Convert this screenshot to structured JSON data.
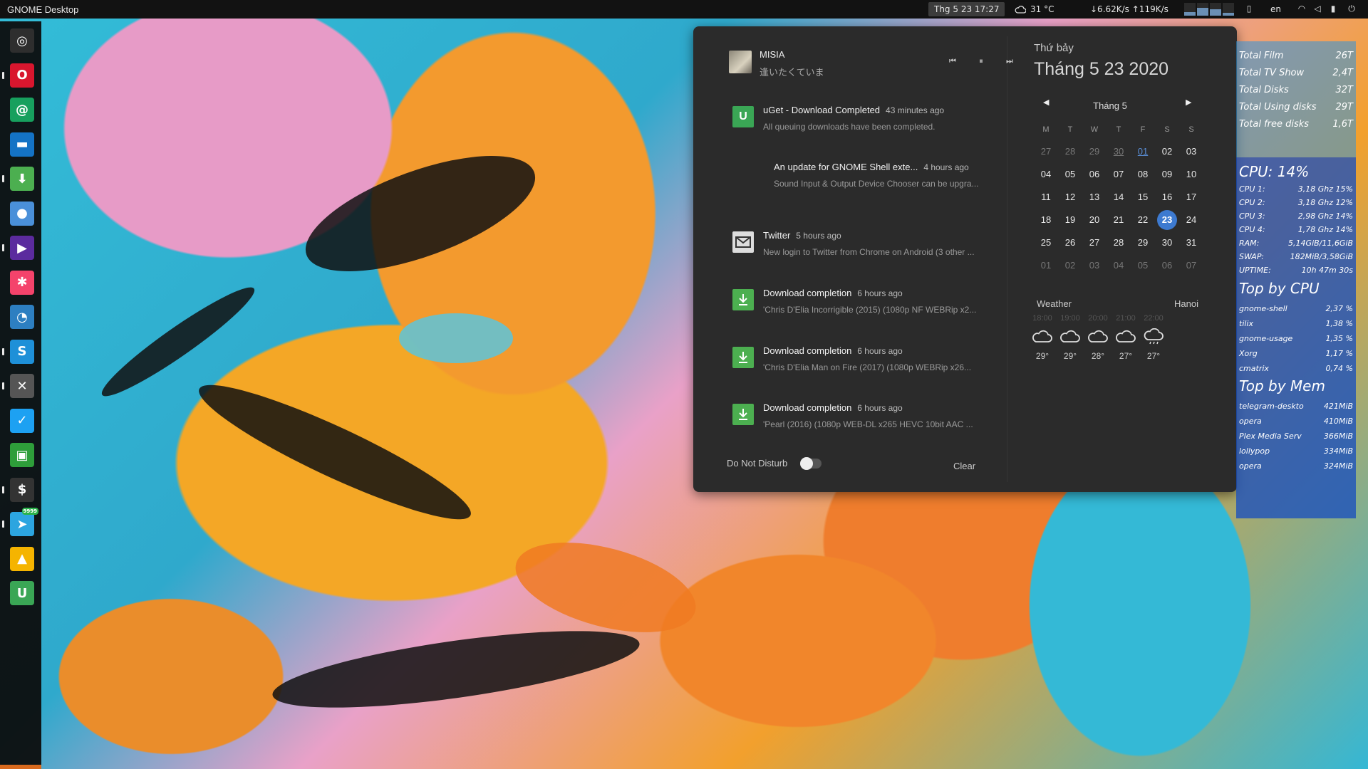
{
  "topbar": {
    "app_title": "GNOME Desktop",
    "clock": "Thg 5 23  17:27",
    "weather_temp": "31 °C",
    "weather_icon": "cloud-icon",
    "netspeed": "↓6.62K/s ↑119K/s",
    "lang": "en",
    "sysmon_levels": [
      0.3,
      0.6,
      0.5,
      0.2
    ]
  },
  "dock": {
    "items": [
      {
        "name": "chromium-icon",
        "glyph": "◎",
        "color": "#2e2e2e"
      },
      {
        "name": "opera-icon",
        "glyph": "O",
        "color": "#d9162e"
      },
      {
        "name": "email-icon",
        "glyph": "@",
        "color": "#17a05e"
      },
      {
        "name": "files-icon",
        "glyph": "▬",
        "color": "#1473c5"
      },
      {
        "name": "downloader-icon",
        "glyph": "⬇",
        "color": "#4caf50"
      },
      {
        "name": "gamepad-icon",
        "glyph": "●",
        "color": "#4a90d9"
      },
      {
        "name": "media-player-icon",
        "glyph": "▶",
        "color": "#5b2b9e"
      },
      {
        "name": "pinwheel-icon",
        "glyph": "✱",
        "color": "#f4436b"
      },
      {
        "name": "system-monitor-icon",
        "glyph": "◔",
        "color": "#2d7fc1"
      },
      {
        "name": "skype-icon",
        "glyph": "S",
        "color": "#1e90d8"
      },
      {
        "name": "tools-icon",
        "glyph": "✕",
        "color": "#555555"
      },
      {
        "name": "twitter-icon",
        "glyph": "✓",
        "color": "#1da1f2"
      },
      {
        "name": "video-icon",
        "glyph": "▣",
        "color": "#2e9e3a"
      },
      {
        "name": "terminal-icon",
        "glyph": "$",
        "color": "#333333"
      },
      {
        "name": "telegram-icon",
        "glyph": "➤",
        "color": "#2ca5e0"
      },
      {
        "name": "google-drive-icon",
        "glyph": "▲",
        "color": "#f5b400"
      },
      {
        "name": "uget-icon",
        "glyph": "U",
        "color": "#3aa655"
      }
    ],
    "telegram_badge": "9999"
  },
  "media": {
    "artist": "MISIA",
    "track": "逢いたくていま"
  },
  "notifications": [
    {
      "title": "uGet - Download Completed",
      "time": "43 minutes ago",
      "body": "All queuing downloads have been completed.",
      "icon": "uget-icon",
      "icon_color": "#3aa655"
    },
    {
      "title": "An update for GNOME Shell exte...",
      "time": "4 hours ago",
      "body": "Sound Input & Output Device Chooser can be upgra...",
      "icon": "",
      "icon_color": ""
    },
    {
      "title": "Twitter",
      "time": "5 hours ago",
      "body": "New login to Twitter from Chrome on Android (3 other ...",
      "icon": "mail-icon",
      "icon_color": ""
    },
    {
      "title": "Download completion",
      "time": "6 hours ago",
      "body": "'Chris D'Elia Incorrigible (2015) (1080p NF WEBRip x2...",
      "icon": "download-icon",
      "icon_color": "#4caf50"
    },
    {
      "title": "Download completion",
      "time": "6 hours ago",
      "body": "'Chris D'Elia Man on Fire (2017) (1080p WEBRip x26...",
      "icon": "download-icon",
      "icon_color": "#4caf50"
    },
    {
      "title": "Download completion",
      "time": "6 hours ago",
      "body": "'Pearl (2016) (1080p WEB-DL x265 HEVC 10bit AAC ...",
      "icon": "download-icon",
      "icon_color": "#4caf50"
    }
  ],
  "footer": {
    "dnd_label": "Do Not Disturb",
    "clear_label": "Clear"
  },
  "calendar": {
    "weekday": "Thứ bảy",
    "date": "Tháng 5 23 2020",
    "month": "Tháng 5",
    "headers": [
      "M",
      "T",
      "W",
      "T",
      "F",
      "S",
      "S"
    ],
    "weeks": [
      [
        {
          "d": "27",
          "o": 1
        },
        {
          "d": "28",
          "o": 1
        },
        {
          "d": "29",
          "o": 1
        },
        {
          "d": "30",
          "o": 1,
          "u": 1
        },
        {
          "d": "01",
          "l": 1,
          "u": 1
        },
        {
          "d": "02"
        },
        {
          "d": "03"
        }
      ],
      [
        {
          "d": "04"
        },
        {
          "d": "05"
        },
        {
          "d": "06"
        },
        {
          "d": "07"
        },
        {
          "d": "08"
        },
        {
          "d": "09"
        },
        {
          "d": "10"
        }
      ],
      [
        {
          "d": "11"
        },
        {
          "d": "12"
        },
        {
          "d": "13"
        },
        {
          "d": "14"
        },
        {
          "d": "15"
        },
        {
          "d": "16"
        },
        {
          "d": "17"
        }
      ],
      [
        {
          "d": "18"
        },
        {
          "d": "19"
        },
        {
          "d": "20"
        },
        {
          "d": "21"
        },
        {
          "d": "22"
        },
        {
          "d": "23",
          "t": 1
        },
        {
          "d": "24"
        }
      ],
      [
        {
          "d": "25"
        },
        {
          "d": "26"
        },
        {
          "d": "27"
        },
        {
          "d": "28"
        },
        {
          "d": "29"
        },
        {
          "d": "30"
        },
        {
          "d": "31"
        }
      ],
      [
        {
          "d": "01",
          "o": 1
        },
        {
          "d": "02",
          "o": 1
        },
        {
          "d": "03",
          "o": 1
        },
        {
          "d": "04",
          "o": 1
        },
        {
          "d": "05",
          "o": 1
        },
        {
          "d": "06",
          "o": 1
        },
        {
          "d": "07",
          "o": 1
        }
      ]
    ]
  },
  "weather": {
    "title": "Weather",
    "location": "Hanoi",
    "forecast": [
      {
        "time": "18:00",
        "temp": "29°",
        "icon": "cloud-icon"
      },
      {
        "time": "19:00",
        "temp": "29°",
        "icon": "cloud-icon"
      },
      {
        "time": "20:00",
        "temp": "28°",
        "icon": "cloud-icon"
      },
      {
        "time": "21:00",
        "temp": "27°",
        "icon": "cloud-icon"
      },
      {
        "time": "22:00",
        "temp": "27°",
        "icon": "cloud-rain-icon"
      }
    ]
  },
  "conky": {
    "storage": [
      {
        "label": "Total Film",
        "value": "26T"
      },
      {
        "label": "Total TV Show",
        "value": "2,4T"
      },
      {
        "label": "Total Disks",
        "value": "32T"
      },
      {
        "label": "Total Using disks",
        "value": "29T"
      },
      {
        "label": "Total free disks",
        "value": "1,6T"
      }
    ],
    "cpu_header": "CPU: 14%",
    "cpus": [
      {
        "label": "CPU 1:",
        "value": "3,18 Ghz 15%"
      },
      {
        "label": "CPU 2:",
        "value": "3,18 Ghz 12%"
      },
      {
        "label": "CPU 3:",
        "value": "2,98 Ghz 14%"
      },
      {
        "label": "CPU 4:",
        "value": "1,78 Ghz 14%"
      },
      {
        "label": "RAM:",
        "value": "5,14GiB/11,6GiB"
      },
      {
        "label": "SWAP:",
        "value": "182MiB/3,58GiB"
      },
      {
        "label": "UPTIME:",
        "value": "10h 47m 30s"
      }
    ],
    "top_cpu_header": "Top by CPU",
    "top_cpu": [
      {
        "label": "gnome-shell",
        "value": "2,37 %"
      },
      {
        "label": "tilix",
        "value": "1,38 %"
      },
      {
        "label": "gnome-usage",
        "value": "1,35 %"
      },
      {
        "label": "Xorg",
        "value": "1,17 %"
      },
      {
        "label": "cmatrix",
        "value": "0,74 %"
      }
    ],
    "top_mem_header": "Top by Mem",
    "top_mem": [
      {
        "label": "telegram-deskto",
        "value": "421MiB"
      },
      {
        "label": "opera",
        "value": "410MiB"
      },
      {
        "label": "Plex Media Serv",
        "value": "366MiB"
      },
      {
        "label": "lollypop",
        "value": "334MiB"
      },
      {
        "label": "opera",
        "value": "324MiB"
      }
    ]
  }
}
